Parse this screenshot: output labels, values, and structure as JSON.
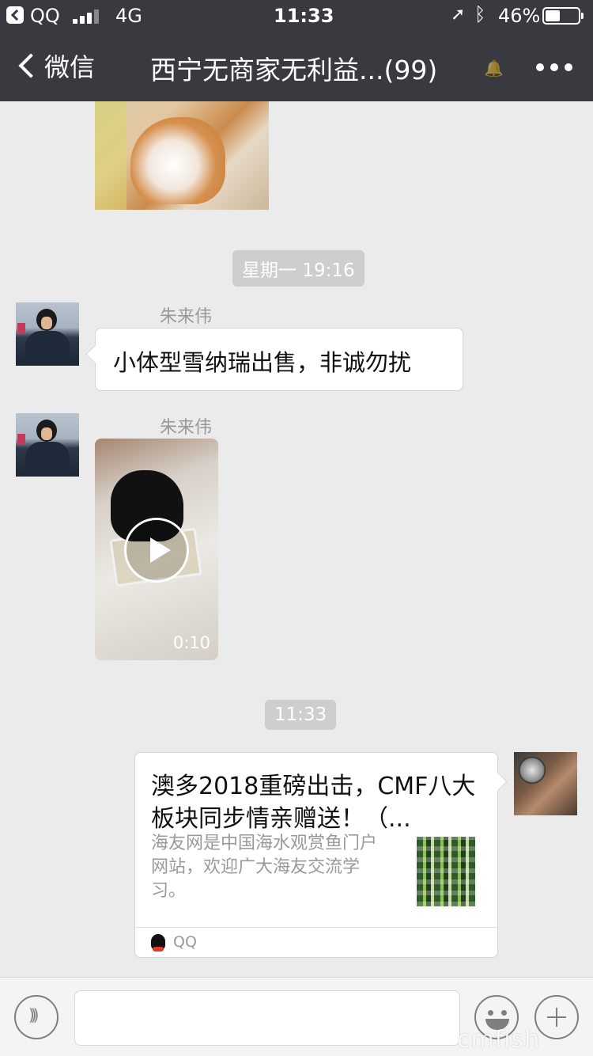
{
  "status_bar": {
    "back_app": "QQ",
    "network": "4G",
    "time": "11:33",
    "battery_pct": "46%",
    "battery_level": 0.46
  },
  "nav": {
    "back_label": "微信",
    "title": "西宁无商家无利益...(99)",
    "icons": [
      "chevron-left-icon",
      "mute-bell-icon",
      "more-icon"
    ]
  },
  "chat": {
    "timestamps": [
      "星期一 19:16",
      "11:33"
    ],
    "messages": [
      {
        "sender": "朱来伟",
        "text": "小体型雪纳瑞出售，非诚勿扰"
      },
      {
        "sender": "朱来伟",
        "video_duration": "0:10"
      }
    ],
    "shared_card": {
      "title": "澳多2018重磅出击，CMF八大板块同步情亲赠送！（...",
      "description": "海友网是中国海水观赏鱼门户网站，欢迎广大海友交流学习。",
      "source": "QQ"
    }
  },
  "input_bar": {
    "icons": [
      "voice-icon",
      "emoji-icon",
      "plus-icon"
    ]
  },
  "watermark": "cmfish"
}
